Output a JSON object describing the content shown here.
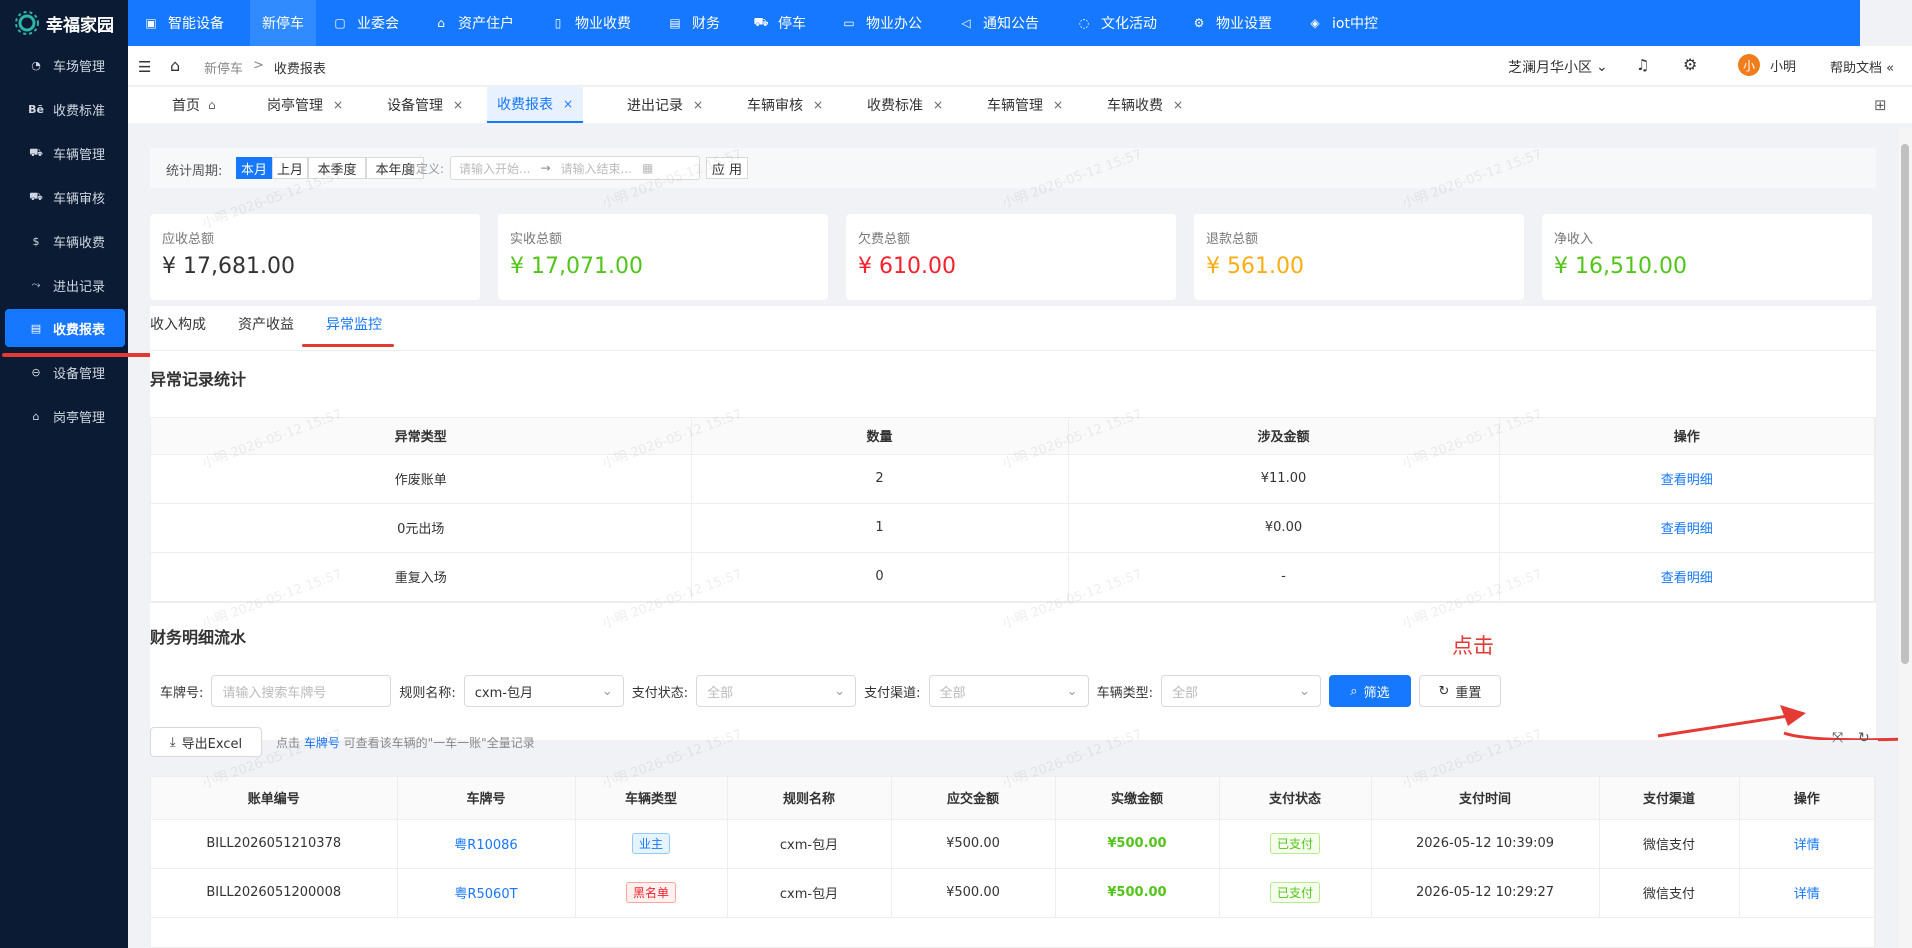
{
  "app": {
    "title": "幸福家园"
  },
  "topnav": [
    {
      "label": "智能设备",
      "icon": "device-icon"
    },
    {
      "label": "新停车",
      "icon": ""
    },
    {
      "label": "业委会",
      "icon": "doc-icon"
    },
    {
      "label": "资产住户",
      "icon": "home-icon"
    },
    {
      "label": "物业收费",
      "icon": "bill-icon"
    },
    {
      "label": "财务",
      "icon": "finance-icon"
    },
    {
      "label": "停车",
      "icon": "car-icon"
    },
    {
      "label": "物业办公",
      "icon": "monitor-icon"
    },
    {
      "label": "通知公告",
      "icon": "megaphone-icon"
    },
    {
      "label": "文化活动",
      "icon": "activity-icon"
    },
    {
      "label": "物业设置",
      "icon": "gear-icon"
    },
    {
      "label": "iot中控",
      "icon": "cube-icon"
    }
  ],
  "sidebar": [
    {
      "label": "车场管理"
    },
    {
      "label": "收费标准"
    },
    {
      "label": "车辆管理"
    },
    {
      "label": "车辆审核"
    },
    {
      "label": "车辆收费"
    },
    {
      "label": "进出记录"
    },
    {
      "label": "收费报表"
    },
    {
      "label": "设备管理"
    },
    {
      "label": "岗亭管理"
    }
  ],
  "header": {
    "breadcrumb": [
      "新停车",
      ">",
      "收费报表"
    ],
    "community": "芝澜月华小区",
    "user": "小明",
    "avatar": "小",
    "help": "帮助文档"
  },
  "tabs": [
    {
      "label": "首页"
    },
    {
      "label": "岗亭管理"
    },
    {
      "label": "设备管理"
    },
    {
      "label": "收费报表"
    },
    {
      "label": "进出记录"
    },
    {
      "label": "车辆审核"
    },
    {
      "label": "收费标准"
    },
    {
      "label": "车辆管理"
    },
    {
      "label": "车辆收费"
    }
  ],
  "filter": {
    "period_label": "统计周期:",
    "periods": [
      "本月",
      "上月",
      "本季度",
      "本年度"
    ],
    "custom_label": "自定义:",
    "start_placeholder": "请输入开始...",
    "arrow": "→",
    "end_placeholder": "请输入结束...",
    "apply": "应 用"
  },
  "cards": [
    {
      "label": "应收总额",
      "value": "¥ 17,681.00",
      "color": "#333333"
    },
    {
      "label": "实收总额",
      "value": "¥ 17,071.00",
      "color": "#52c41a"
    },
    {
      "label": "欠费总额",
      "value": "¥ 610.00",
      "color": "#f5222d"
    },
    {
      "label": "退款总额",
      "value": "¥ 561.00",
      "color": "#faad14"
    },
    {
      "label": "净收入",
      "value": "¥ 16,510.00",
      "color": "#52c41a"
    }
  ],
  "subtabs": [
    "收入构成",
    "资产收益",
    "异常监控"
  ],
  "anomaly": {
    "title": "异常记录统计",
    "headers": [
      "异常类型",
      "数量",
      "涉及金额",
      "操作"
    ],
    "rows": [
      {
        "type": "作废账单",
        "count": "2",
        "amount": "¥11.00",
        "action": "查看明细"
      },
      {
        "type": "0元出场",
        "count": "1",
        "amount": "¥0.00",
        "action": "查看明细"
      },
      {
        "type": "重复入场",
        "count": "0",
        "amount": "-",
        "action": "查看明细"
      }
    ]
  },
  "annotation": {
    "text": "点击"
  },
  "ledger": {
    "title": "财务明细流水",
    "filters": {
      "plate_label": "车牌号:",
      "plate_placeholder": "请输入搜索车牌号",
      "rule_label": "规则名称:",
      "rule_value": "cxm-包月",
      "pay_status_label": "支付状态:",
      "pay_status_value": "全部",
      "channel_label": "支付渠道:",
      "channel_value": "全部",
      "vehicle_type_label": "车辆类型:",
      "vehicle_type_value": "全部",
      "search": "筛选",
      "reset": "重置"
    },
    "export": "导出Excel",
    "hint_prefix": "点击 ",
    "hint_link": "车牌号",
    "hint_suffix": " 可查看该车辆的\"一车一账\"全量记录",
    "headers": [
      "账单编号",
      "车牌号",
      "车辆类型",
      "规则名称",
      "应交金额",
      "实缴金额",
      "支付状态",
      "支付时间",
      "支付渠道",
      "操作"
    ],
    "rows": [
      {
        "id": "BILL2026051210378",
        "plate": "粤R10086",
        "vtype": "业主",
        "rule": "cxm-包月",
        "due": "¥500.00",
        "paid": "¥500.00",
        "status": "已支付",
        "time": "2026-05-12 10:39:09",
        "channel": "微信支付",
        "action": "详情"
      },
      {
        "id": "BILL2026051200008",
        "plate": "粤R5060T",
        "vtype": "黑名单",
        "rule": "cxm-包月",
        "due": "¥500.00",
        "paid": "¥500.00",
        "status": "已支付",
        "time": "2026-05-12 10:29:27",
        "channel": "微信支付",
        "action": "详情"
      }
    ]
  },
  "watermark": "小明 2026-05-12 15:57"
}
